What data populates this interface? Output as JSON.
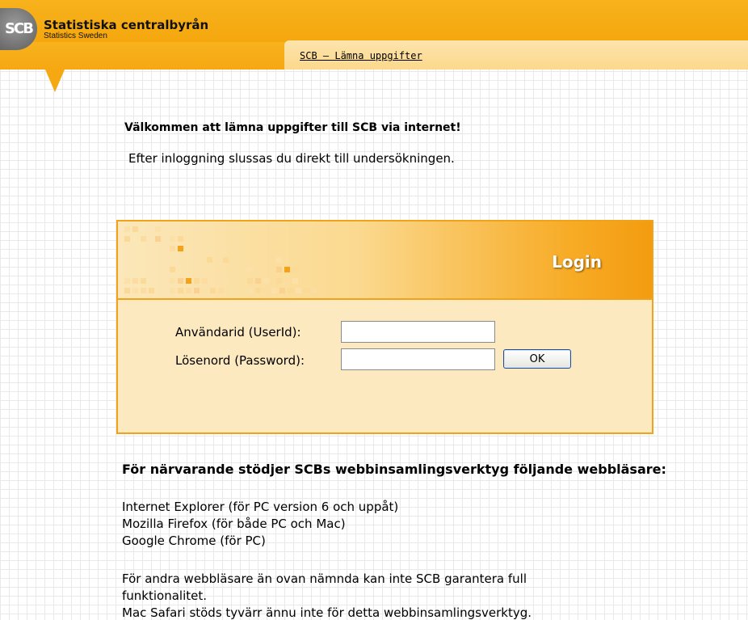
{
  "header": {
    "logo_text": "SCB",
    "brand_name": "Statistiska centralbyrån",
    "brand_sub": "Statistics Sweden",
    "nav_link": "SCB – Lämna uppgifter"
  },
  "welcome": {
    "title": "Välkommen att lämna uppgifter till SCB via internet!",
    "text": "Efter inloggning slussas du direkt till undersökningen."
  },
  "login": {
    "title": "Login",
    "userid_label": "Användarid (UserId):",
    "userid_value": "",
    "password_label": "Lösenord (Password):",
    "password_value": "",
    "ok_label": "OK"
  },
  "info": {
    "heading": "För närvarande stödjer SCBs webbinsamlingsverktyg följande webbläsare:",
    "browsers": [
      "Internet Explorer (för PC version 6 och uppåt)",
      "Mozilla Firefox (för både PC och Mac)",
      "Google Chrome (för PC)"
    ],
    "note_line1": "För andra webbläsare än ovan nämnda kan inte SCB garantera full",
    "note_line2": "funktionalitet.",
    "note_line3": "Mac Safari stöds tyvärr ännu inte för detta webbinsamlingsverktyg."
  },
  "colors": {
    "brand_orange": "#f6a812",
    "panel_fill": "#fde9bf",
    "panel_border": "#f0a31a"
  }
}
